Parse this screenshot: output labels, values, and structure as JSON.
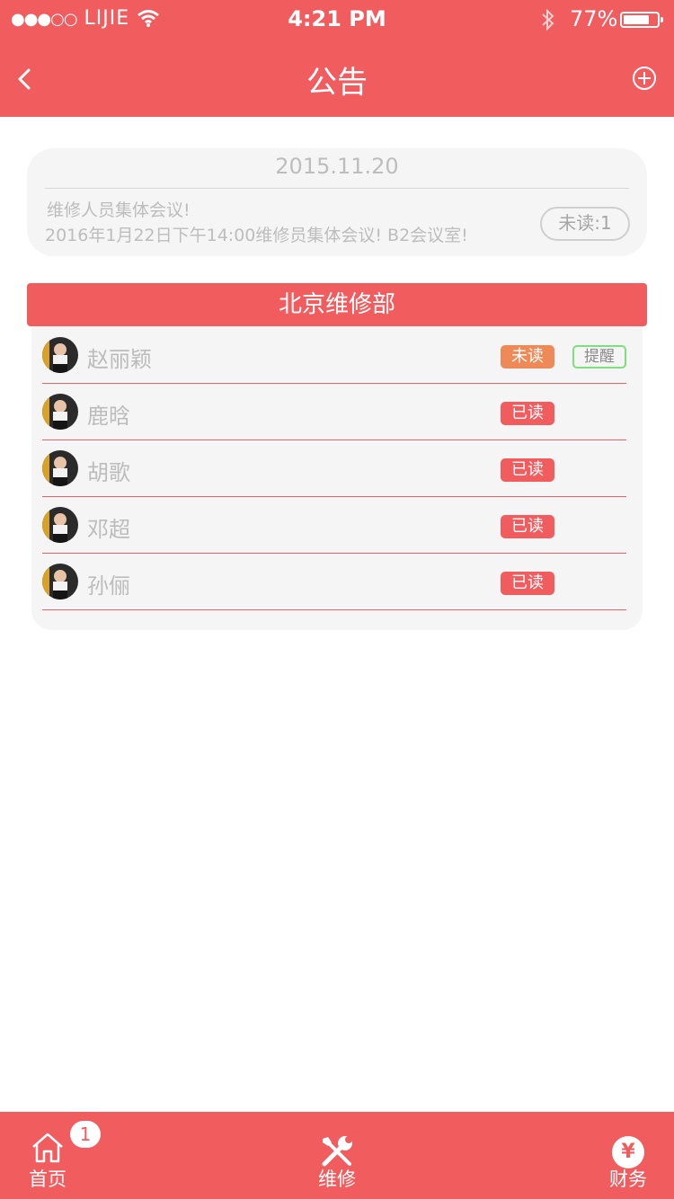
{
  "status_bar": {
    "carrier": "LIJIE",
    "time": "4:21 PM",
    "battery": "77%",
    "battery_level": 0.77
  },
  "nav": {
    "title": "公告"
  },
  "notice": {
    "date": "2015.11.20",
    "subject": "维修人员集体会议!",
    "body": "2016年1月22日下午14:00维修员集体会议! B2会议室!",
    "unread_label": "未读:1"
  },
  "department": {
    "name": "北京维修部",
    "members": [
      {
        "name": "赵丽颖",
        "status": "未读",
        "remind": "提醒"
      },
      {
        "name": "鹿晗",
        "status": "已读"
      },
      {
        "name": "胡歌",
        "status": "已读"
      },
      {
        "name": "邓超",
        "status": "已读"
      },
      {
        "name": "孙俪",
        "status": "已读"
      }
    ]
  },
  "tabbar": {
    "tabs": [
      {
        "label": "首页",
        "badge": "1"
      },
      {
        "label": "维修"
      },
      {
        "label": "财务",
        "icon_text": "¥"
      }
    ]
  },
  "colors": {
    "brand": "#f15c5f",
    "unread": "#ee8a57",
    "read": "#f15c5f",
    "remind_border": "#7ee07a"
  },
  "icons": [
    "back-icon",
    "add-circle-icon",
    "wifi-icon",
    "bluetooth-icon",
    "battery-icon",
    "home-icon",
    "tools-icon",
    "yen-icon"
  ]
}
